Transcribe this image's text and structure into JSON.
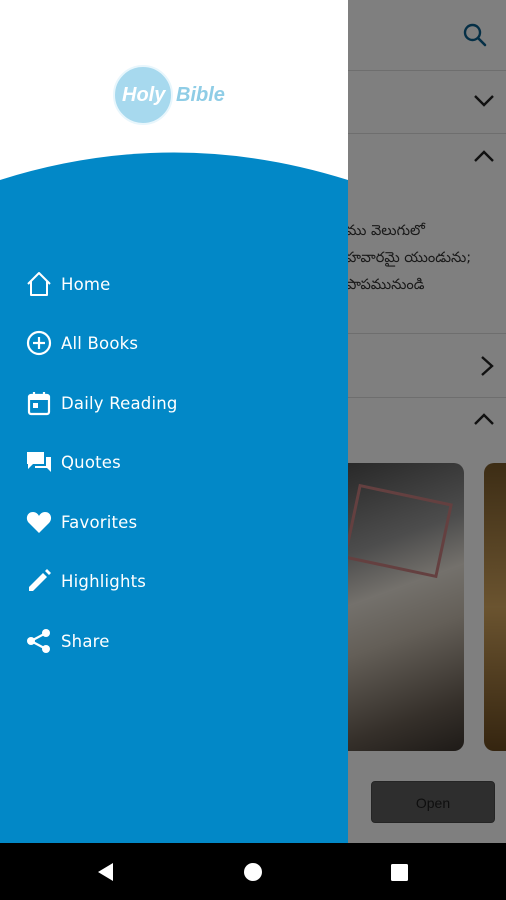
{
  "drawer": {
    "logo": {
      "word1": "Holy",
      "word2": "Bible"
    },
    "accent_color": "#0288c7",
    "items": [
      {
        "label": "Home",
        "icon": "home-icon"
      },
      {
        "label": "All Books",
        "icon": "add-circle-icon"
      },
      {
        "label": "Daily Reading",
        "icon": "calendar-icon"
      },
      {
        "label": "Quotes",
        "icon": "quotes-icon"
      },
      {
        "label": "Favorites",
        "icon": "heart-icon"
      },
      {
        "label": "Highlights",
        "icon": "pencil-icon"
      },
      {
        "label": "Share",
        "icon": "share-icon"
      }
    ]
  },
  "background": {
    "verse_lines": [
      "ము వెలుగులో",
      "హవారమై యుండును;",
      "పాపమునుండి"
    ],
    "open_button_label": "Open",
    "icons": [
      "search-icon",
      "chevron-down-icon",
      "chevron-up-icon",
      "chevron-right-icon"
    ]
  },
  "navbar": {
    "buttons": [
      "back-icon",
      "home-circle-icon",
      "recents-icon"
    ]
  }
}
